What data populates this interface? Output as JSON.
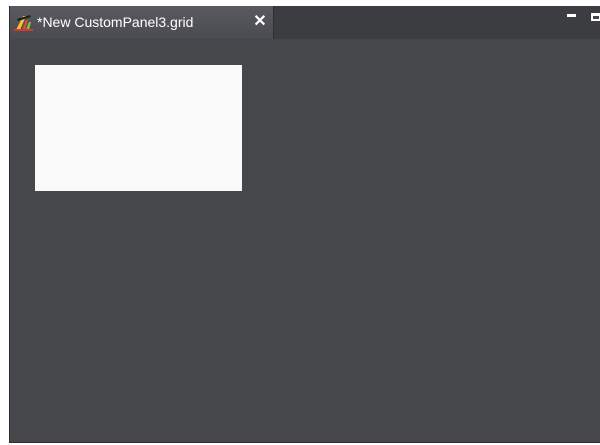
{
  "editor": {
    "tab": {
      "title": "*New CustomPanel3.grid",
      "close_label": "✕",
      "icon": "application-icon"
    },
    "window_controls": {
      "minimize_icon": "minimize-icon",
      "maximize_icon": "maximize-icon"
    },
    "colors": {
      "background": "#46474b",
      "tab_background": "#55565b",
      "panel_fill": "#fafafa"
    }
  }
}
